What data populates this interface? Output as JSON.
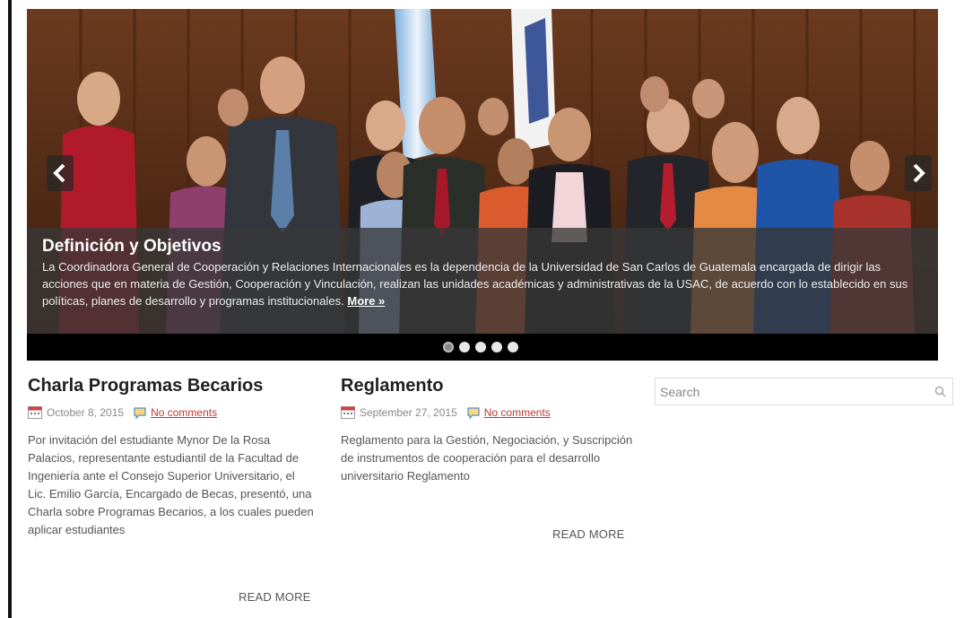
{
  "slider": {
    "caption_title": "Definición y Objetivos",
    "caption_text": "La Coordinadora General de Cooperación y Relaciones Internacionales es la dependencia de la Universidad de San Carlos de Guatemala encargada de dirigir las acciones que en materia de Gestión, Cooperación y Vinculación, realizan las unidades académicas y administrativas de la USAC, de acuerdo con lo establecido en sus políticas, planes de desarrollo y programas institucionales.",
    "more_label": "More »",
    "prev_icon": "chevron-left-icon",
    "next_icon": "chevron-right-icon",
    "slide_count": 5,
    "active_slide": 1
  },
  "posts": [
    {
      "title": "Charla Programas Becarios",
      "date": "October 8, 2015",
      "comments": "No comments",
      "excerpt": "Por invitación del estudiante Mynor De la Rosa Palacios, representante estudiantil de la Facultad de Ingeniería ante el Consejo Superior Universitario, el Lic. Emilio García, Encargado de Becas, presentó, una Charla sobre Programas Becarios, a los cuales pueden aplicar estudiantes",
      "read_more": "READ MORE"
    },
    {
      "title": "Reglamento",
      "date": "September 27, 2015",
      "comments": "No comments",
      "excerpt": "Reglamento para la Gestión, Negociación, y Suscripción de instrumentos de cooperación para el desarrollo universitario Reglamento",
      "read_more": "READ MORE"
    }
  ],
  "search": {
    "placeholder": "Search",
    "icon": "search-icon"
  },
  "colors": {
    "link": "#c0392b",
    "caption_bg": "#373737",
    "slider_bar": "#000000"
  }
}
